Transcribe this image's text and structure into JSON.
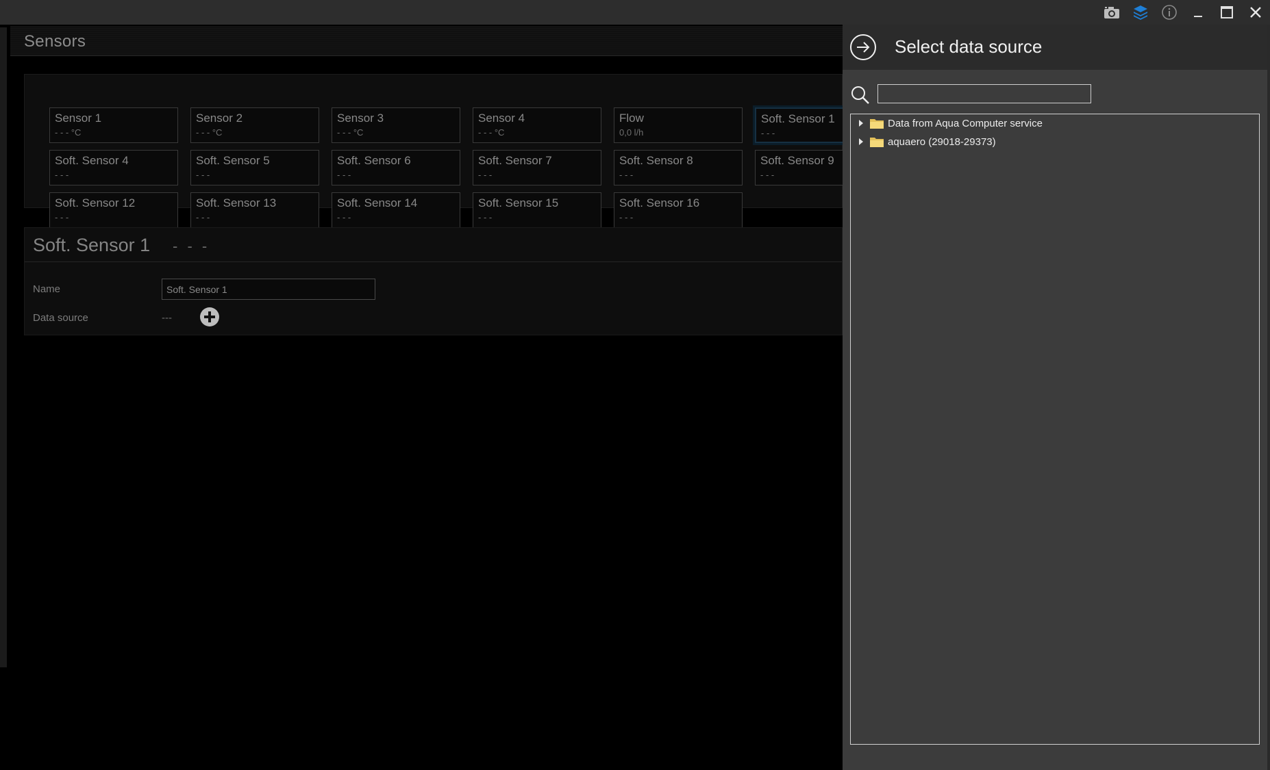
{
  "titlebar": {
    "icons": [
      "camera-icon",
      "layers-icon",
      "info-icon",
      "minimize-icon",
      "maximize-icon",
      "close-icon"
    ],
    "accent": "#1e7fd6"
  },
  "main": {
    "section_title": "Sensors",
    "tiles": [
      {
        "name": "Sensor 1",
        "value": "- - - °C"
      },
      {
        "name": "Sensor 2",
        "value": "- - - °C"
      },
      {
        "name": "Sensor 3",
        "value": "- - - °C"
      },
      {
        "name": "Sensor 4",
        "value": "- - - °C"
      },
      {
        "name": "Flow",
        "value": "0,0 l/h"
      },
      {
        "name": "Soft. Sensor 1",
        "value": "- - -"
      },
      {
        "name": "Soft. Sensor 4",
        "value": "- - -"
      },
      {
        "name": "Soft. Sensor 5",
        "value": "- - -"
      },
      {
        "name": "Soft. Sensor 6",
        "value": "- - -"
      },
      {
        "name": "Soft. Sensor 7",
        "value": "- - -"
      },
      {
        "name": "Soft. Sensor 8",
        "value": "- - -"
      },
      {
        "name": "Soft. Sensor 9",
        "value": "- - -"
      },
      {
        "name": "Soft. Sensor 12",
        "value": "- - -"
      },
      {
        "name": "Soft. Sensor 13",
        "value": "- - -"
      },
      {
        "name": "Soft. Sensor 14",
        "value": "- - -"
      },
      {
        "name": "Soft. Sensor 15",
        "value": "- - -"
      },
      {
        "name": "Soft. Sensor 16",
        "value": "- - -"
      }
    ],
    "detail": {
      "title": "Soft. Sensor 1",
      "value": "- - -",
      "name_label": "Name",
      "name_value": "Soft. Sensor 1",
      "datasource_label": "Data source",
      "datasource_value": "---"
    }
  },
  "drawer": {
    "title": "Select data source",
    "search_value": "",
    "tree": [
      {
        "label": "Data from Aqua Computer service"
      },
      {
        "label": "aquaero (29018-29373)"
      }
    ]
  }
}
